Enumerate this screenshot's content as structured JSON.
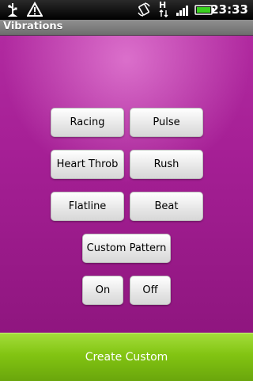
{
  "status_bar": {
    "time": "23:33",
    "network_label": "H",
    "icons": [
      "usb-icon",
      "warning-icon",
      "rotation-icon",
      "network-type-icon",
      "signal-icon",
      "battery-icon"
    ]
  },
  "app": {
    "title": "Vibrations"
  },
  "buttons": {
    "racing": "Racing",
    "pulse": "Pulse",
    "heart_throb": "Heart Throb",
    "rush": "Rush",
    "flatline": "Flatline",
    "beat": "Beat",
    "custom_pattern": "Custom Pattern",
    "on": "On",
    "off": "Off"
  },
  "footer": {
    "create_custom": "Create Custom"
  },
  "colors": {
    "background": "#a51f95",
    "accent_green": "#82c412",
    "button": "#e6e6e6"
  }
}
